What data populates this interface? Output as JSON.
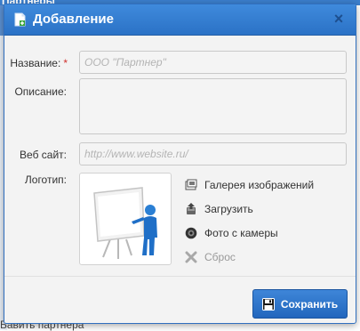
{
  "background": {
    "top_text": "Партнеры",
    "bottom_text": "Бавить партнера"
  },
  "dialog": {
    "title": "Добавление",
    "close_symbol": "×"
  },
  "form": {
    "name_label": "Название:",
    "required_mark": "*",
    "name_placeholder": "ООО \"Партнер\"",
    "name_value": "",
    "description_label": "Описание:",
    "description_value": "",
    "website_label": "Веб сайт:",
    "website_placeholder": "http://www.website.ru/",
    "website_value": "",
    "logo_label": "Логотип:"
  },
  "logo_actions": [
    {
      "label": "Галерея изображений",
      "icon": "gallery-icon",
      "enabled": true
    },
    {
      "label": "Загрузить",
      "icon": "upload-icon",
      "enabled": true
    },
    {
      "label": "Фото с камеры",
      "icon": "camera-icon",
      "enabled": true
    },
    {
      "label": "Сброс",
      "icon": "reset-icon",
      "enabled": false
    }
  ],
  "footer": {
    "save_label": "Сохранить"
  },
  "colors": {
    "titlebar": "#2b72c6",
    "required": "#d0312d",
    "button": "#2266bd"
  }
}
